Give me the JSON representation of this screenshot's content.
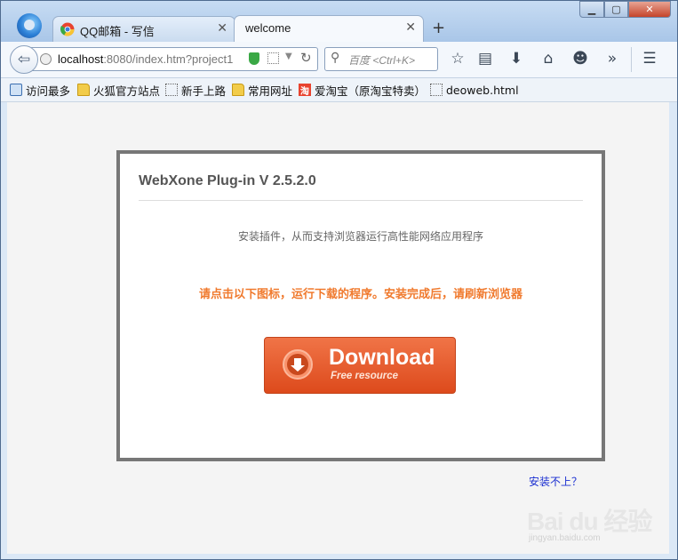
{
  "window": {
    "controls": {
      "minimize": "▁",
      "maximize": "▢",
      "close": "✕"
    }
  },
  "tabs": [
    {
      "label": "QQ邮箱 - 写信",
      "active": false,
      "icon": "chrome-style-icon"
    },
    {
      "label": "welcome",
      "active": true
    }
  ],
  "new_tab_label": "+",
  "navbar": {
    "url_host": "localhost",
    "url_rest": ":8080/index.htm?project1",
    "search_placeholder": "百度 <Ctrl+K>"
  },
  "bookmarks": [
    {
      "label": "访问最多",
      "icon": "history-icon"
    },
    {
      "label": "火狐官方站点",
      "icon": "folder-icon"
    },
    {
      "label": "新手上路",
      "icon": "page-icon"
    },
    {
      "label": "常用网址",
      "icon": "folder-icon"
    },
    {
      "label": "爱淘宝（原淘宝特卖）",
      "icon": "taobao-icon",
      "icon_text": "淘"
    },
    {
      "label": "deoweb.html",
      "icon": "page-icon"
    }
  ],
  "card": {
    "title": "WebXone Plug-in V 2.5.2.0",
    "description": "安装插件，从而支持浏览器运行高性能网络应用程序",
    "instruction": "请点击以下图标，运行下载的程序。安装完成后，请刷新浏览器",
    "download": {
      "label": "Download",
      "sublabel": "Free resource"
    }
  },
  "help_link": "安装不上？",
  "watermark": {
    "logo": "Bai du 经验",
    "sub": "jingyan.baidu.com"
  },
  "colors": {
    "accent_orange": "#f07a2e",
    "button": "#e55a2b",
    "link": "#1b2fd1"
  }
}
